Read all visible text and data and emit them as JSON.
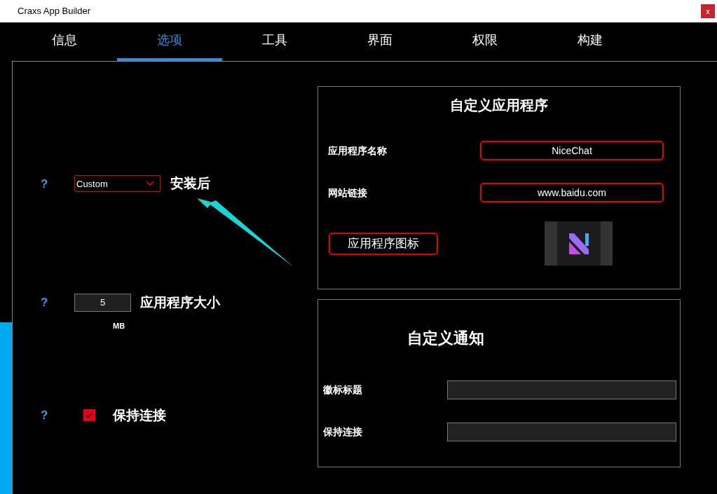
{
  "window": {
    "title": "Craxs App Builder",
    "close": "x"
  },
  "tabs": [
    {
      "label": "信息",
      "selected": false
    },
    {
      "label": "选项",
      "selected": true
    },
    {
      "label": "工具",
      "selected": false
    },
    {
      "label": "界面",
      "selected": false
    },
    {
      "label": "权限",
      "selected": false
    },
    {
      "label": "构建",
      "selected": false
    }
  ],
  "options": [
    {
      "kind": "dropdown",
      "help": "?",
      "value": "Custom",
      "label": "安装后"
    },
    {
      "kind": "number",
      "help": "?",
      "value": "5",
      "unit": "MB",
      "label": "应用程序大小"
    },
    {
      "kind": "checkbox",
      "help": "?",
      "checked": true,
      "label": "保持连接"
    }
  ],
  "custom_app": {
    "title": "自定义应用程序",
    "fields": [
      {
        "label": "应用程序名称",
        "value": "NiceChat"
      },
      {
        "label": "网站链接",
        "value": "www.baidu.com"
      }
    ],
    "icon_button": "应用程序图标"
  },
  "custom_notification": {
    "title": "自定义通知",
    "fields": [
      {
        "label": "徽标标题"
      },
      {
        "label": "保持连接"
      }
    ]
  }
}
